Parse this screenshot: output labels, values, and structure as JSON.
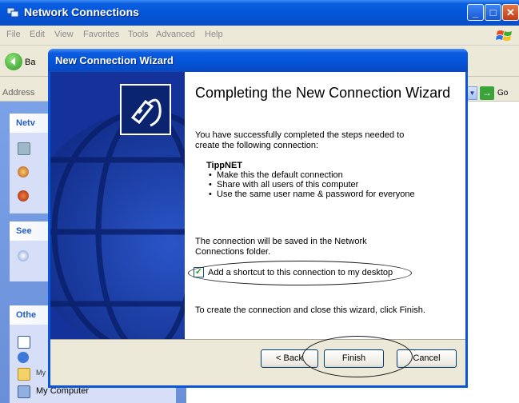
{
  "background_window": {
    "title": "Network Connections",
    "menu": [
      "File",
      "Edit",
      "View",
      "Favorites",
      "Tools",
      "Advanced",
      "Help"
    ],
    "toolbar_back_label": "Ba",
    "address_label": "Address",
    "go_label": "Go",
    "left_pane": {
      "panel1_header": "Netv",
      "panel2_header": "See",
      "panel3_header": "Othe",
      "links": {
        "my_documents": "My Documents",
        "my_computer": "My Computer"
      }
    }
  },
  "wizard": {
    "title": "New Connection Wizard",
    "heading": "Completing the New Connection Wizard",
    "intro": "You have successfully completed the steps needed to create the following connection:",
    "connection_name": "TippNET",
    "bullets": [
      "Make this the default connection",
      "Share with all users of this computer",
      "Use the same user name & password for everyone"
    ],
    "save_note": "The connection will be saved in the Network Connections folder.",
    "shortcut_checkbox_label": "Add a shortcut to this connection to my desktop",
    "shortcut_checked": true,
    "finish_note": "To create the connection and close this wizard, click Finish.",
    "buttons": {
      "back": "< Back",
      "finish": "Finish",
      "cancel": "Cancel"
    }
  },
  "colors": {
    "xp_title_blue": "#0453d8",
    "wizard_side": "#14329a",
    "task_link_blue": "#215dc6",
    "checkmark_green": "#21a121"
  }
}
